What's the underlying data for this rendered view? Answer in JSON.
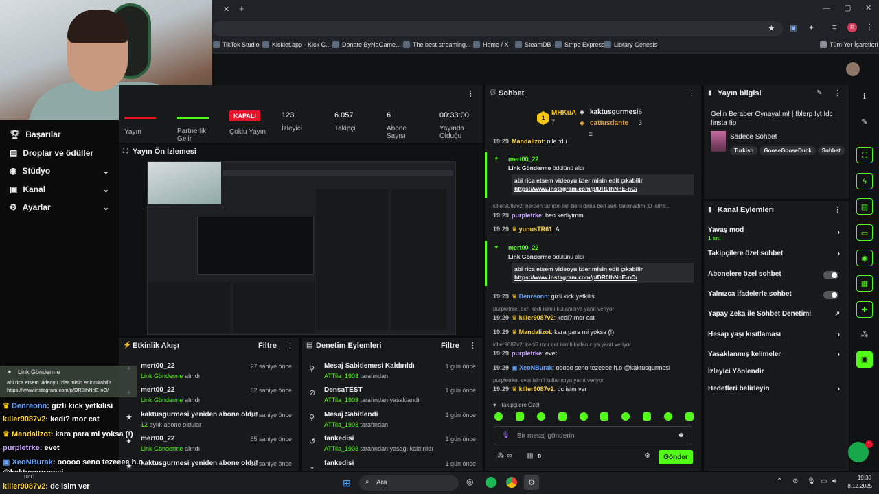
{
  "browser": {
    "new_tab": "+",
    "bookmarks": [
      "TikTok Studio",
      "Kicklet.app - Kick C...",
      "Donate ByNoGame...",
      "The best streaming...",
      "Home / X",
      "SteamDB",
      "Stripe Express",
      "Library Genesis"
    ],
    "all_bookmarks": "Tüm Yer İşaretleri",
    "profile_initial": "R"
  },
  "sidebar": {
    "items": [
      {
        "label": "Başarılar",
        "icon": "trophy-icon"
      },
      {
        "label": "Droplar ve ödüller",
        "icon": "gift-icon"
      },
      {
        "label": "Stüdyo",
        "icon": "studio-icon"
      },
      {
        "label": "Kanal",
        "icon": "channel-icon"
      },
      {
        "label": "Ayarlar",
        "icon": "gear-icon"
      }
    ]
  },
  "stats": {
    "stream_label": "Yayın",
    "partner_label": "Partnerlik Gelir",
    "multi_badge": "KAPALI",
    "multi_label": "Çoklu Yayın",
    "viewers_value": "123",
    "viewers_label": "İzleyici",
    "followers_value": "6.057",
    "followers_label": "Takipçi",
    "subs_value": "6",
    "subs_label": "Abone Sayısı",
    "time_value": "00:33:00",
    "time_label": "Yayında Olduğu"
  },
  "preview": {
    "title": "Yayın Ön İzlemesi"
  },
  "activity": {
    "title": "Etkinlik Akışı",
    "filter": "Filtre",
    "items": [
      {
        "title": "mert00_22",
        "sub": "Link Gönderme",
        "sub2": "alındı",
        "time": "27 saniye önce"
      },
      {
        "title": "mert00_22",
        "sub": "Link Gönderme",
        "sub2": "alındı",
        "time": "32 saniye önce"
      },
      {
        "title": "kaktusgurmesi yeniden abone oldu!",
        "sub": "12",
        "sub2": "aylık abone oldular",
        "time": "54 saniye önce"
      },
      {
        "title": "mert00_22",
        "sub": "Link Gönderme",
        "sub2": "alındı",
        "time": "55 saniye önce"
      },
      {
        "title": "kaktusgurmesi yeniden abone oldu!",
        "sub": "",
        "sub2": "",
        "time": "58 saniye önce"
      }
    ]
  },
  "moderation": {
    "title": "Denetim Eylemleri",
    "filter": "Filtre",
    "items": [
      {
        "title": "Mesaj Sabitlemesi Kaldırıldı",
        "user": "ATTila_1903",
        "rest": "tarafından",
        "time": "1 gün önce"
      },
      {
        "title": "DensaTEST",
        "user": "ATTila_1903",
        "rest": "tarafından yasaklandı",
        "time": "1 gün önce"
      },
      {
        "title": "Mesaj Sabitlendi",
        "user": "ATTila_1903",
        "rest": "tarafından",
        "time": "1 gün önce"
      },
      {
        "title": "fankedisi",
        "user": "ATTila_1903",
        "rest": "tarafından yasağı kaldırıldı",
        "time": "1 gün önce"
      },
      {
        "title": "fankedisi",
        "user": "",
        "rest": "",
        "time": "1 gün önce"
      }
    ]
  },
  "chat": {
    "title": "Sohbet",
    "top1_name": "MHKuA",
    "top1_count": "7",
    "top1_rank": "1",
    "top2_name": "kaktusgurmesi",
    "top2_count": "6",
    "top3_name": "cattusdante",
    "top3_count": "3",
    "cut_line_time": "19:29",
    "cut_line_user": "Mandalizot",
    "cut_line_text": ": nile :du",
    "hl1_user": "mert00_22",
    "hl1_sub": "Link Gönderme",
    "hl1_sub2": "ödülünü aldı",
    "hl1_q": "abi rica etsem videoyu izler misin edit çıkabilir",
    "hl1_link": "https://www.instagram.com/p/DR0IhNnE-nO/",
    "reply1": "killer9087v2: nerden tanıdın lan beni daha ben seni tanımadım :D isimli...",
    "m1_time": "19:29",
    "m1_user": "purpletrke",
    "m1_text": ": ben kediyimm",
    "m2_time": "19:29",
    "m2_user": "yunusTR61",
    "m2_text": ": A",
    "hl2_user": "mert00_22",
    "hl2_sub": "Link Gönderme",
    "hl2_sub2": "ödülünü aldı",
    "hl2_q": "abi rica etsem videoyu izler misin edit çıkabilir",
    "hl2_link": "https://www.instagram.com/p/DR0IhNnE-nO/",
    "m3_time": "19:29",
    "m3_user": "Denreonn",
    "m3_text": ": gizli kick yetkilisi",
    "reply2": "purpletrke: ben kedi isimli kullanıcıya yanıt veriyor",
    "m4_time": "19:29",
    "m4_user": "killer9087v2",
    "m4_text": ": kedi? mor cat",
    "m5_time": "19:29",
    "m5_user": "Mandalizot",
    "m5_text": ": kara para mi yoksa (!)",
    "reply3": "killer9087v2: kedi? mor cat isimli kullanıcıya yanıt veriyor",
    "m6_time": "19:29",
    "m6_user": "purpletrke",
    "m6_text": ": evet",
    "m7_time": "19:29",
    "m7_user": "XeoNBurak",
    "m7_text": ": ooooo seno tezeeee h.o @kaktusgurmesi",
    "reply4": "purpletrke: evet isimli kullanıcıya yanıt veriyor",
    "m8_time": "19:29",
    "m8_user": "killer9087v2",
    "m8_text": ": dc isim ver",
    "followers_only": "Takipçilere Özel",
    "input_placeholder": "Bir mesaj gönderin",
    "points": "∞",
    "gifts": "0",
    "send": "Gönder"
  },
  "info": {
    "title": "Yayın bilgisi",
    "stream_title": "Gelin Beraber Oynayalım! | !blerp !yt !dc !insta !ip",
    "category_label": "Sadece Sohbet",
    "tags": [
      "Turkish",
      "GooseGooseDuck",
      "Sohbet"
    ]
  },
  "actions": {
    "title": "Kanal Eylemleri",
    "items": [
      {
        "label": "Yavaş mod",
        "sub": "1 sn.",
        "ctrl": "›"
      },
      {
        "label": "Takipçilere özel sohbet",
        "sub": "",
        "ctrl": "›"
      },
      {
        "label": "Abonelere özel sohbet",
        "sub": "",
        "ctrl": "toggle"
      },
      {
        "label": "Yalnızca ifadelerle sohbet",
        "sub": "",
        "ctrl": "toggle"
      },
      {
        "label": "Yapay Zeka ile Sohbet Denetimi",
        "sub": "",
        "ctrl": "↗"
      },
      {
        "label": "Hesap yaşı kısıtlaması",
        "sub": "",
        "ctrl": "›"
      },
      {
        "label": "Yasaklanmış kelimeler",
        "sub": "",
        "ctrl": "›"
      },
      {
        "label": "İzleyici Yönlendir",
        "sub": "",
        "ctrl": ""
      },
      {
        "label": "Hedefleri belirleyin",
        "sub": "",
        "ctrl": "›"
      }
    ]
  },
  "overlay": {
    "notif_title": "Link Gönderme",
    "notif_text": "abi rica etsem videoyu izler misin edit çıkabilir https://www.instagram.com/p/DR0IhNnE-nO/",
    "lines": [
      {
        "user": "Denreonn",
        "text": ": gizli kick yetkilisi",
        "color": "#6aa7ff"
      },
      {
        "user": "killer9087v2",
        "text": ": kedi? mor cat",
        "color": "#ffd84a"
      },
      {
        "user": "Mandalizot",
        "text": ": kara para mi yoksa (!)",
        "color": "#ffd84a"
      },
      {
        "user": "purpletrke",
        "text": ": evet",
        "color": "#c9a6ff"
      },
      {
        "user": "XeoNBurak",
        "text": ": ooooo seno tezeeee h.o",
        "color": "#6aa7ff"
      },
      {
        "user": "@kaktusgurmesi",
        "text": "",
        "color": "#ffffff"
      },
      {
        "user": "killer9087v2",
        "text": ": dc isim ver",
        "color": "#ffd84a"
      }
    ]
  },
  "taskbar": {
    "search": "Ara",
    "weather": "10°C",
    "time": "19:30",
    "date": "8.12.2025"
  },
  "notif_badge": "1",
  "colors": {
    "accent": "#53fc18",
    "bg": "#0b0b0c",
    "panel": "#18191b",
    "red": "#e5132b"
  }
}
